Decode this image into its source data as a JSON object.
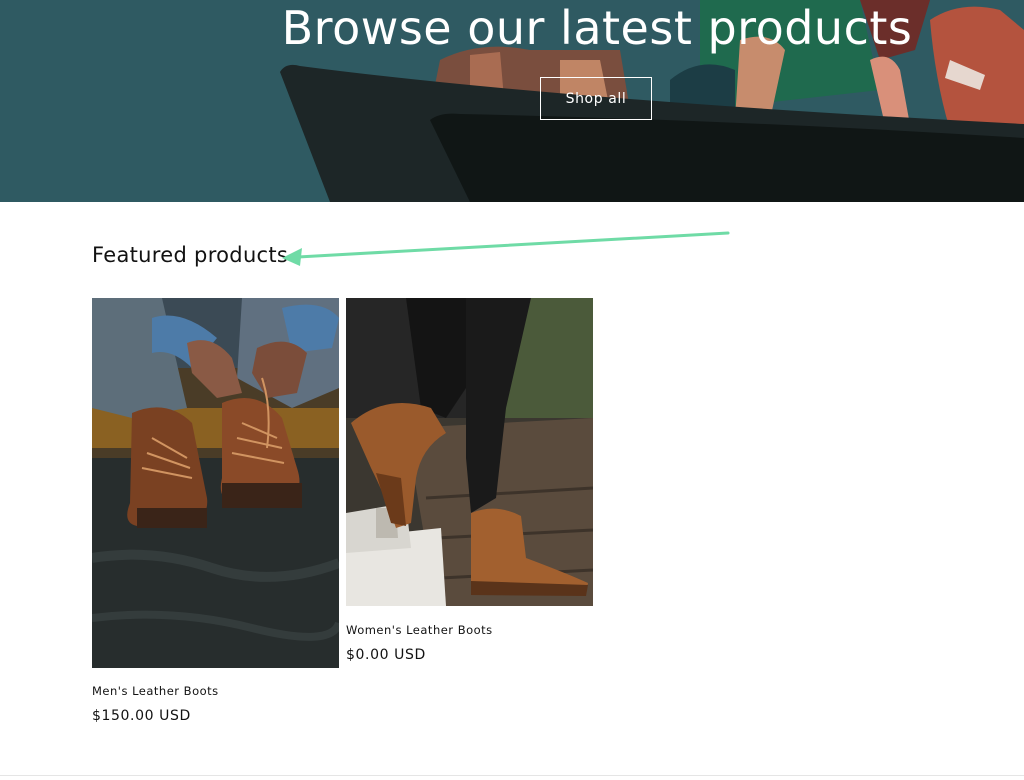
{
  "hero": {
    "title": "Browse our latest products",
    "button_label": "Shop all",
    "bg_color": "#2f5a62"
  },
  "featured": {
    "title": "Featured products",
    "annotation_color": "#6fdba6",
    "products": [
      {
        "name": "Men's Leather Boots",
        "price": "$150.00 USD"
      },
      {
        "name": "Women's Leather Boots",
        "price": "$0.00 USD"
      }
    ]
  }
}
